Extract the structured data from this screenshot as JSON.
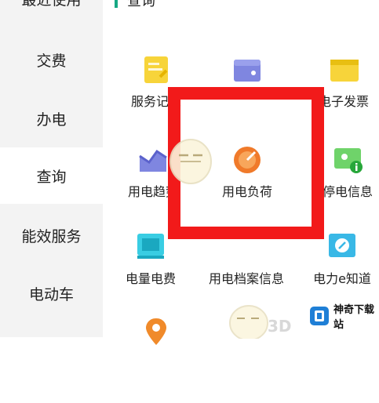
{
  "sidebar": {
    "items": [
      {
        "label": "最近使用"
      },
      {
        "label": "交费"
      },
      {
        "label": "办电"
      },
      {
        "label": "查询"
      },
      {
        "label": "能效服务"
      },
      {
        "label": "电动车"
      }
    ],
    "active_index": 3
  },
  "section": {
    "title": "查询"
  },
  "grid": {
    "items": [
      {
        "label": "服务记录",
        "icon": "document-icon"
      },
      {
        "label": "",
        "icon": "wallet-icon"
      },
      {
        "label": "电子发票",
        "icon": "invoice-icon"
      },
      {
        "label": "用电趋势",
        "icon": "trend-icon"
      },
      {
        "label": "用电负荷",
        "icon": "gauge-icon"
      },
      {
        "label": "停电信息",
        "icon": "power-outage-icon"
      },
      {
        "label": "电量电费",
        "icon": "bill-icon"
      },
      {
        "label": "用电档案信息",
        "icon": "archive-icon"
      },
      {
        "label": "电力e知道",
        "icon": "knowledge-icon"
      },
      {
        "label": "",
        "icon": "location-icon"
      },
      {
        "label": "",
        "icon": "more-icon"
      }
    ]
  },
  "colors": {
    "accent": "#17a884",
    "highlight_box": "#f21a1a",
    "sidebar_bg": "#f3f3f3"
  },
  "watermark": {
    "text": "神奇下载站",
    "badge": "3D"
  }
}
